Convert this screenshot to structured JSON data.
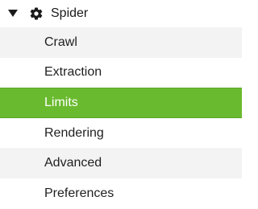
{
  "tree": {
    "header": {
      "label": "Spider",
      "caret_icon": "caret-down-icon",
      "icon": "gear-icon"
    },
    "items": [
      {
        "label": "Crawl"
      },
      {
        "label": "Extraction"
      },
      {
        "label": "Limits",
        "selected": true
      },
      {
        "label": "Rendering"
      },
      {
        "label": "Advanced"
      },
      {
        "label": "Preferences"
      }
    ]
  },
  "colors": {
    "selected_background": "#6aba2f",
    "selected_text": "#ffffff",
    "alternate_row": "#f3f3f3",
    "text": "#1f1f1f"
  }
}
